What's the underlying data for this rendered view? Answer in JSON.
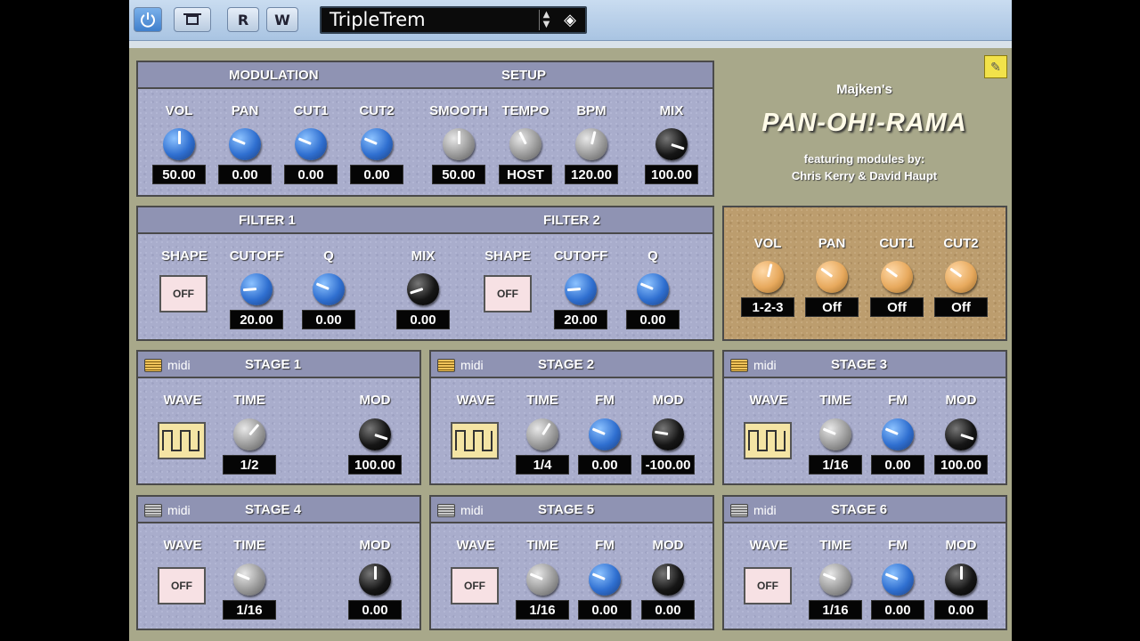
{
  "host": {
    "power_icon": "power-icon",
    "bypass_icon": "bypass-icon",
    "read_label": "R",
    "write_label": "W",
    "preset_name": "TripleTrem"
  },
  "colors": {
    "panel": "#a9adcc",
    "header": "#8f93b3",
    "knob_blue": "#2f6fd0",
    "knob_orange": "#e7a95d",
    "control_box": "#bc9d6e",
    "background": "#a8a88a"
  },
  "brand": {
    "author": "Majken's",
    "title": "PAN-OH!-RAMA",
    "featuring": "featuring modules by:",
    "credits": "Chris Kerry & David Haupt"
  },
  "modulation": {
    "title": "MODULATION",
    "setup_title": "SETUP",
    "knobs": [
      {
        "label": "VOL",
        "value": "50.00",
        "type": "blue",
        "level": 0.5
      },
      {
        "label": "PAN",
        "value": "0.00",
        "type": "blue",
        "level": 0.25
      },
      {
        "label": "CUT1",
        "value": "0.00",
        "type": "blue",
        "level": 0.25
      },
      {
        "label": "CUT2",
        "value": "0.00",
        "type": "blue",
        "level": 0.25
      },
      {
        "label": "SMOOTH",
        "value": "50.00",
        "type": "grey",
        "level": 0.5
      },
      {
        "label": "TEMPO",
        "value": "HOST",
        "type": "grey",
        "level": 0.4
      },
      {
        "label": "BPM",
        "value": "120.00",
        "type": "grey",
        "level": 0.55
      },
      {
        "label": "MIX",
        "value": "100.00",
        "type": "black",
        "level": 0.9
      }
    ]
  },
  "filters": {
    "filter1_title": "FILTER 1",
    "filter2_title": "FILTER 2",
    "shape_label": "SHAPE",
    "shape1_value": "OFF",
    "shape2_value": "OFF",
    "knobs": [
      {
        "label": "CUTOFF",
        "value": "20.00",
        "type": "blue",
        "level": 0.15
      },
      {
        "label": "Q",
        "value": "0.00",
        "type": "blue",
        "level": 0.25
      },
      {
        "label": "MIX",
        "value": "0.00",
        "type": "black",
        "level": 0.1
      },
      {
        "label": "CUTOFF",
        "value": "20.00",
        "type": "blue",
        "level": 0.15
      },
      {
        "label": "Q",
        "value": "0.00",
        "type": "blue",
        "level": 0.25
      }
    ]
  },
  "routing": {
    "knobs": [
      {
        "label": "VOL",
        "value": "1-2-3",
        "level": 0.55
      },
      {
        "label": "PAN",
        "value": "Off",
        "level": 0.3
      },
      {
        "label": "CUT1",
        "value": "Off",
        "level": 0.3
      },
      {
        "label": "CUT2",
        "value": "Off",
        "level": 0.3
      }
    ]
  },
  "stages": [
    {
      "title": "STAGE 1",
      "midi": "midi",
      "midi_on": true,
      "wave": "square",
      "time": "1/2",
      "time_level": 0.65,
      "fm": null,
      "mod": "100.00",
      "mod_level": 0.9
    },
    {
      "title": "STAGE 2",
      "midi": "midi",
      "midi_on": true,
      "wave": "square",
      "time": "1/4",
      "time_level": 0.62,
      "fm": "0.00",
      "fm_level": 0.25,
      "mod": "-100.00",
      "mod_level": 0.2
    },
    {
      "title": "STAGE 3",
      "midi": "midi",
      "midi_on": true,
      "wave": "square",
      "time": "1/16",
      "time_level": 0.25,
      "fm": "0.00",
      "fm_level": 0.25,
      "mod": "100.00",
      "mod_level": 0.9
    },
    {
      "title": "STAGE 4",
      "midi": "midi",
      "midi_on": false,
      "wave": "OFF",
      "time": "1/16",
      "time_level": 0.25,
      "fm": null,
      "mod": "0.00",
      "mod_level": 0.5
    },
    {
      "title": "STAGE 5",
      "midi": "midi",
      "midi_on": false,
      "wave": "OFF",
      "time": "1/16",
      "time_level": 0.25,
      "fm": "0.00",
      "fm_level": 0.25,
      "mod": "0.00",
      "mod_level": 0.5
    },
    {
      "title": "STAGE 6",
      "midi": "midi",
      "midi_on": false,
      "wave": "OFF",
      "time": "1/16",
      "time_level": 0.25,
      "fm": "0.00",
      "fm_level": 0.25,
      "mod": "0.00",
      "mod_level": 0.5
    }
  ],
  "stage_labels": {
    "wave": "WAVE",
    "time": "TIME",
    "fm": "FM",
    "mod": "MOD"
  }
}
